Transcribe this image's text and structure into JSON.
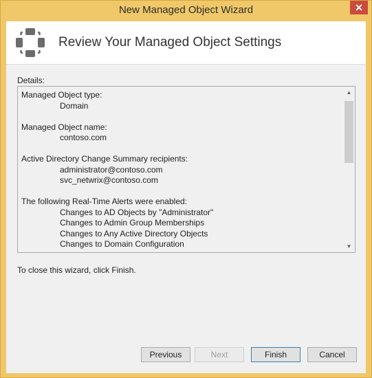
{
  "window": {
    "title": "New Managed Object Wizard",
    "close_glyph": "✕"
  },
  "header": {
    "title": "Review Your Managed Object Settings",
    "icon": "managed-object-nodes-icon"
  },
  "details": {
    "label": "Details:",
    "lines": [
      "Managed Object type:",
      "Domain",
      "Managed Object name:",
      "contoso.com",
      "Active Directory Change Summary recipients:",
      "administrator@contoso.com",
      "svc_netwrix@contoso.com",
      "The following Real-Time Alerts were enabled:",
      "Changes to AD Objects by \"Administrator\"",
      "Changes to Admin Group Memberships",
      "Changes to Any Active Directory Objects",
      "Changes to Domain Configuration"
    ],
    "scroll_up_glyph": "▲",
    "scroll_down_glyph": "▼"
  },
  "footer_text": "To close this wizard, click Finish.",
  "buttons": {
    "previous": "Previous",
    "next": "Next",
    "finish": "Finish",
    "cancel": "Cancel"
  }
}
